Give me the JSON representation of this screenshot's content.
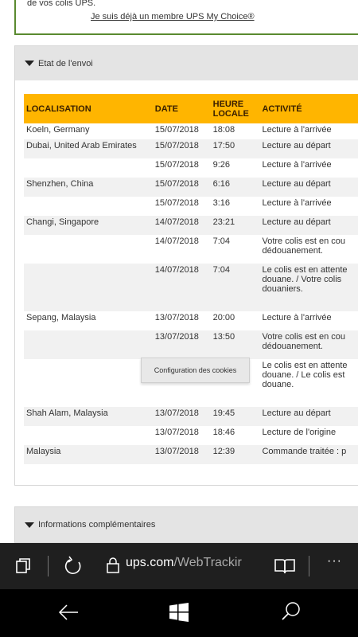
{
  "promo": {
    "text": "de vos colis UPS.",
    "link": "Je suis déjà un membre UPS My Choice®"
  },
  "shipment_section": {
    "title": "Etat de l'envoi",
    "columns": [
      "LOCALISATION",
      "DATE",
      "HEURE LOCALE",
      "ACTIVITÉ"
    ],
    "rows": [
      {
        "location": "Koeln, Germany",
        "date": "15/07/2018",
        "time": "18:08",
        "activity": "Lecture à l'arrivée"
      },
      {
        "location": "Dubai, United Arab Emirates",
        "date": "15/07/2018",
        "time": "17:50",
        "activity": "Lecture au départ"
      },
      {
        "location": "",
        "date": "15/07/2018",
        "time": "9:26",
        "activity": "Lecture à l'arrivée"
      },
      {
        "location": "Shenzhen, China",
        "date": "15/07/2018",
        "time": "6:16",
        "activity": "Lecture au départ"
      },
      {
        "location": "",
        "date": "15/07/2018",
        "time": "3:16",
        "activity": "Lecture à l'arrivée"
      },
      {
        "location": "Changi, Singapore",
        "date": "14/07/2018",
        "time": "23:21",
        "activity": "Lecture au départ"
      },
      {
        "location": "",
        "date": "14/07/2018",
        "time": "7:04",
        "activity": "Votre colis est en cou dédouanement."
      },
      {
        "location": "",
        "date": "14/07/2018",
        "time": "7:04",
        "activity": "Le colis est en attente douane. / Votre colis douaniers."
      },
      {
        "location": "Sepang, Malaysia",
        "date": "13/07/2018",
        "time": "20:00",
        "activity": "Lecture à l'arrivée"
      },
      {
        "location": "",
        "date": "13/07/2018",
        "time": "13:50",
        "activity": "Votre colis est en cou dédouanement."
      },
      {
        "location": "",
        "date": "",
        "time": "",
        "activity": "Le colis est en attente douane. / Le colis est douane."
      },
      {
        "location": "Shah Alam, Malaysia",
        "date": "13/07/2018",
        "time": "19:45",
        "activity": "Lecture au départ"
      },
      {
        "location": "",
        "date": "13/07/2018",
        "time": "18:46",
        "activity": "Lecture de l'origine"
      },
      {
        "location": "Malaysia",
        "date": "13/07/2018",
        "time": "12:39",
        "activity": "Commande traitée : p"
      }
    ]
  },
  "cookie_button": "Configuration des cookies",
  "info_section": {
    "title": "Informations complémentaires"
  },
  "browser": {
    "url_host": "ups.com",
    "url_path": "/WebTrackir",
    "more_label": "···"
  },
  "colors": {
    "header_orange": "#ffb500",
    "green_border": "#5a8a30",
    "address_bar": "#1f1f1f"
  },
  "icons": [
    "tabs-icon",
    "refresh-icon",
    "lock-icon",
    "reading-view-icon",
    "more-icon",
    "back-icon",
    "windows-icon",
    "search-icon",
    "caret-down-icon"
  ]
}
